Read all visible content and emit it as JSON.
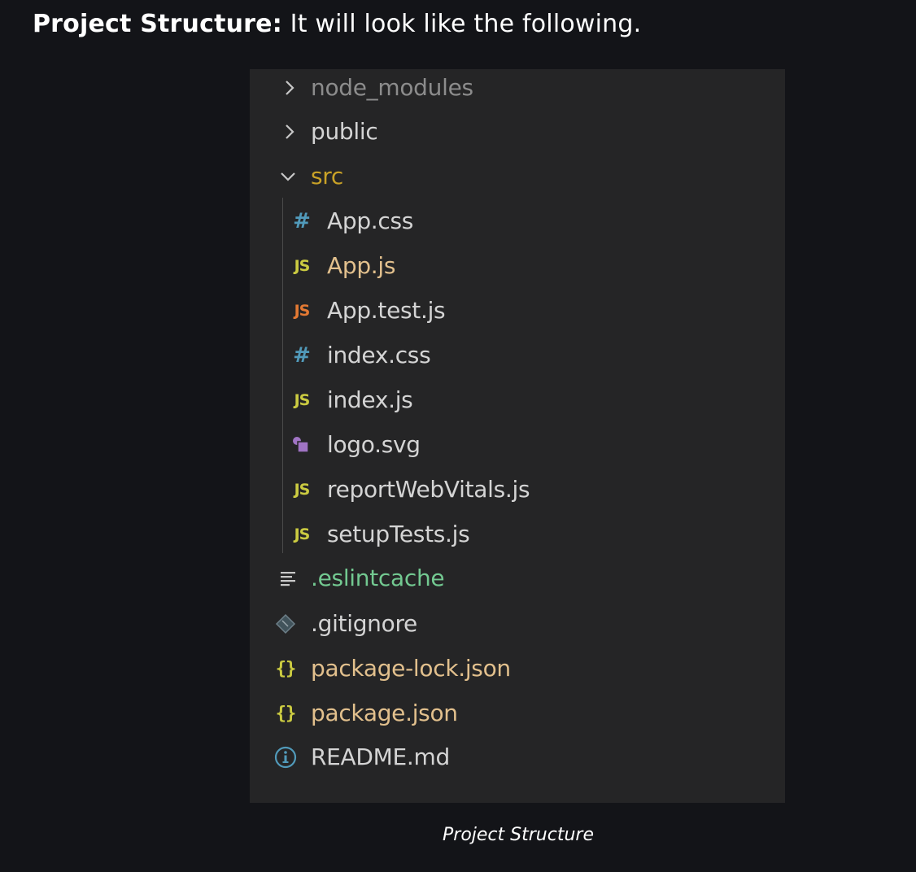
{
  "heading": {
    "bold": "Project Structure:",
    "text": " It will look like the following."
  },
  "caption": "Project Structure",
  "colors": {
    "page_background": "#131418",
    "explorer_background": "#252526",
    "default_text": "#d4d4d4",
    "folder_open_text": "#c9a227",
    "modified_text": "#e2c08d",
    "untracked_text": "#73c991",
    "dimmed_text": "#8c8c8c"
  },
  "tree": [
    {
      "label": "node_modules",
      "kind": "folder-collapsed",
      "icon": "chevron-right-icon",
      "depth": 0
    },
    {
      "label": "public",
      "kind": "folder-collapsed",
      "icon": "chevron-right-icon",
      "depth": 0
    },
    {
      "label": "src",
      "kind": "folder-expanded",
      "icon": "chevron-down-icon",
      "depth": 0
    },
    {
      "label": "App.css",
      "kind": "file",
      "icon": "css-hash-icon",
      "depth": 1
    },
    {
      "label": "App.js",
      "kind": "file",
      "icon": "javascript-icon",
      "icon_text": "JS",
      "depth": 1
    },
    {
      "label": "App.test.js",
      "kind": "file",
      "icon": "javascript-test-icon",
      "icon_text": "JS",
      "depth": 1
    },
    {
      "label": "index.css",
      "kind": "file",
      "icon": "css-hash-icon",
      "depth": 1
    },
    {
      "label": "index.js",
      "kind": "file",
      "icon": "javascript-icon",
      "icon_text": "JS",
      "depth": 1
    },
    {
      "label": "logo.svg",
      "kind": "file",
      "icon": "svg-image-icon",
      "depth": 1
    },
    {
      "label": "reportWebVitals.js",
      "kind": "file",
      "icon": "javascript-icon",
      "icon_text": "JS",
      "depth": 1
    },
    {
      "label": "setupTests.js",
      "kind": "file",
      "icon": "javascript-icon",
      "icon_text": "JS",
      "depth": 1
    },
    {
      "label": ".eslintcache",
      "kind": "file",
      "icon": "text-lines-icon",
      "depth": 0
    },
    {
      "label": ".gitignore",
      "kind": "file",
      "icon": "git-diamond-icon",
      "depth": 0
    },
    {
      "label": "package-lock.json",
      "kind": "file",
      "icon": "json-braces-icon",
      "icon_text": "{}",
      "depth": 0
    },
    {
      "label": "package.json",
      "kind": "file",
      "icon": "json-braces-icon",
      "icon_text": "{}",
      "depth": 0
    },
    {
      "label": "README.md",
      "kind": "file",
      "icon": "info-circle-icon",
      "depth": 0
    }
  ]
}
